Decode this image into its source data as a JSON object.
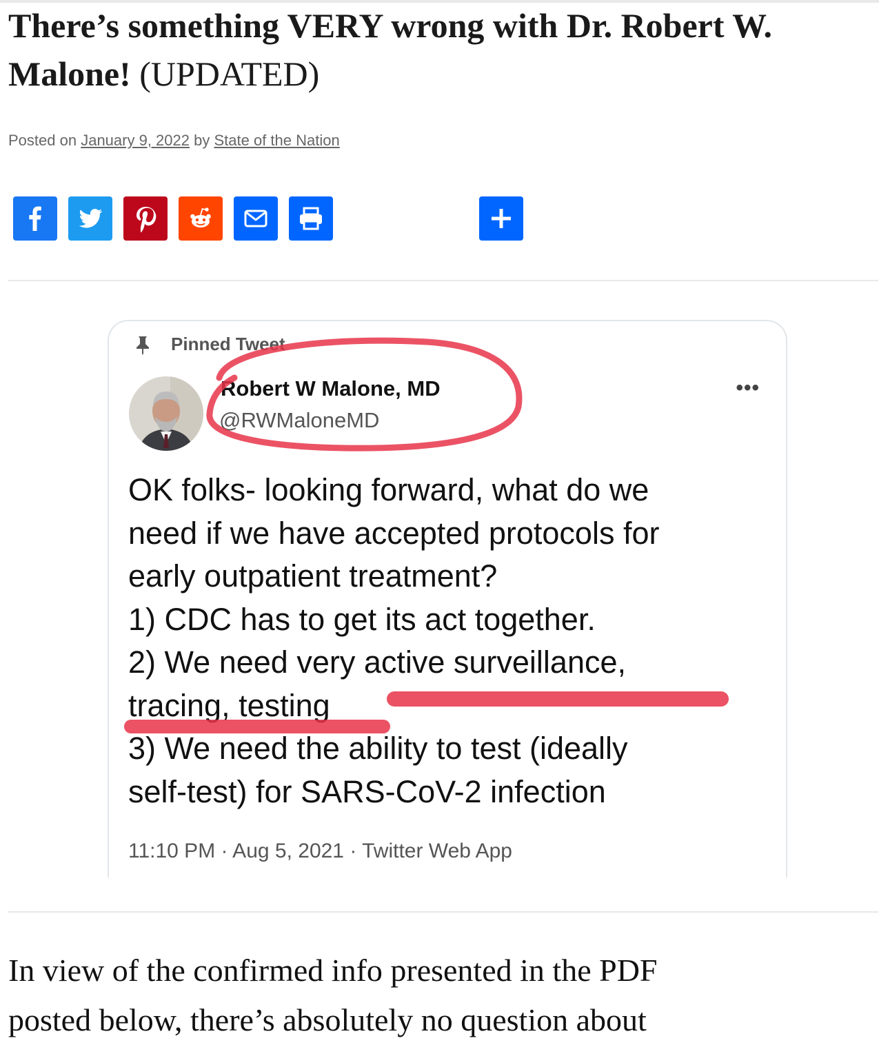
{
  "post": {
    "title_bold": "There’s something VERY wrong with Dr. Robert W. Malone!",
    "title_tag": "(UPDATED)",
    "meta": {
      "posted_on": "Posted on",
      "date": "January 9, 2022",
      "by": "by",
      "author": "State of the Nation"
    },
    "share_buttons": [
      {
        "name": "facebook",
        "icon": "facebook-icon",
        "color": "#1877f2"
      },
      {
        "name": "twitter",
        "icon": "twitter-icon",
        "color": "#1d9bf0"
      },
      {
        "name": "pinterest",
        "icon": "pinterest-icon",
        "color": "#bd081c"
      },
      {
        "name": "reddit",
        "icon": "reddit-icon",
        "color": "#ff4500"
      },
      {
        "name": "email",
        "icon": "email-icon",
        "color": "#0166ff"
      },
      {
        "name": "print",
        "icon": "print-icon",
        "color": "#0166ff"
      },
      {
        "name": "more",
        "icon": "plus-icon",
        "color": "#0166ff"
      }
    ],
    "paragraph_lines": [
      "In view of the confirmed info presented in the PDF",
      "posted below, there’s absolutely no question about"
    ]
  },
  "tweet": {
    "pinned_label": "Pinned Tweet",
    "name": "Robert W Malone, MD",
    "handle": "@RWMaloneMD",
    "more_icon": "ellipsis-icon",
    "body_lines": [
      "OK folks- looking forward, what do we",
      "need if we have accepted protocols for",
      "early outpatient treatment?",
      "1) CDC has to get its act together.",
      "2) We need very active surveillance,",
      "tracing, testing",
      "3) We need the ability to test (ideally",
      "self-test) for SARS-CoV-2 infection"
    ],
    "footer": "11:10 PM · Aug 5, 2021 · Twitter Web App",
    "annotation_color": "#e8354a"
  }
}
